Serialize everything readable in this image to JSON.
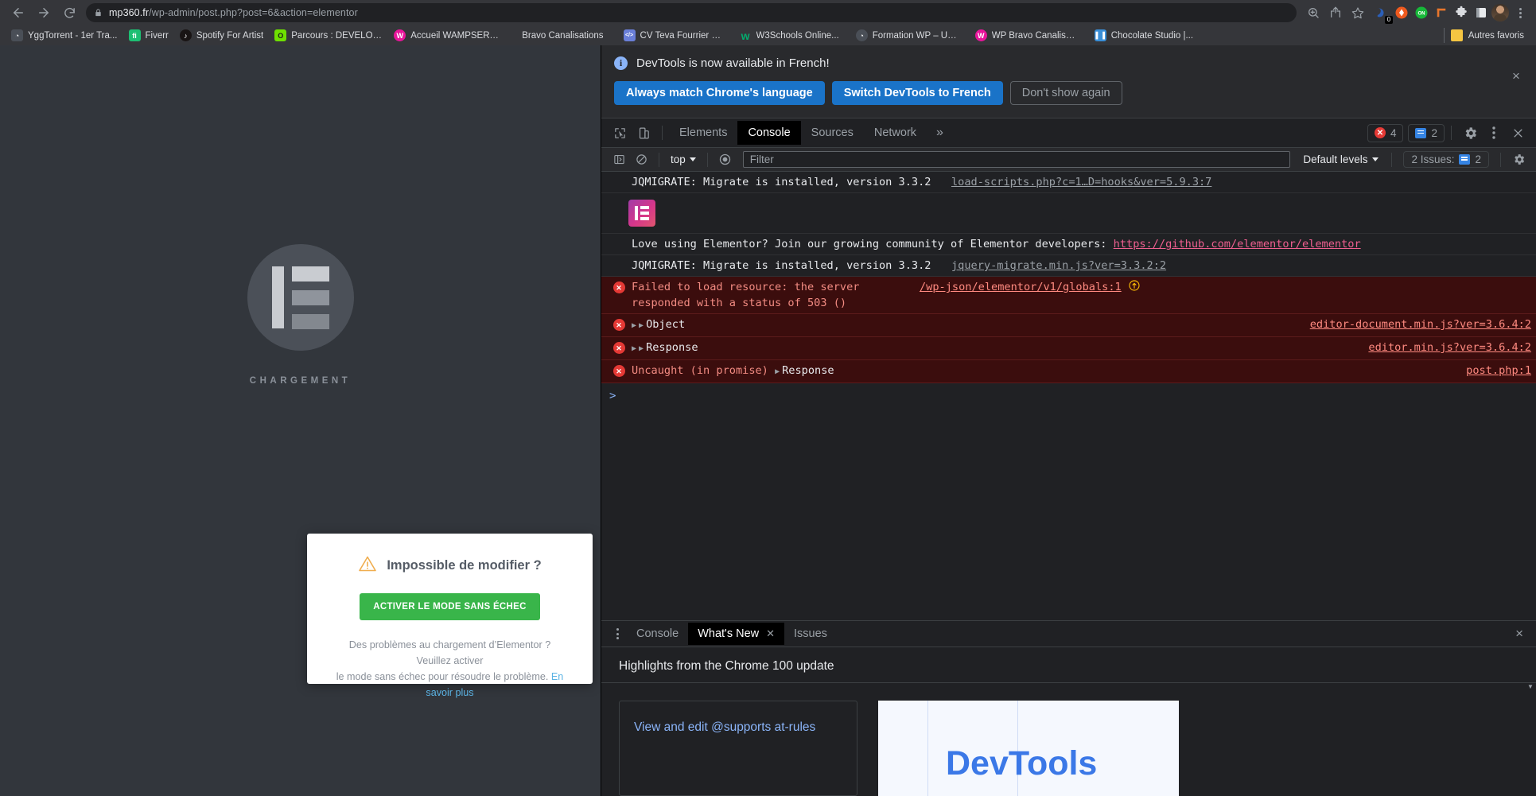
{
  "browser": {
    "url_host": "mp360.fr",
    "url_path": "/wp-admin/post.php?post=6&action=elementor",
    "nav": {
      "back": "Back",
      "forward": "Forward",
      "reload": "Reload"
    },
    "omnibox_icons": [
      "zoom-icon",
      "share-icon",
      "bookmark-star-icon"
    ],
    "extensions": [
      {
        "name": "mendeley-extension",
        "badge": "0"
      },
      {
        "name": "diamond-extension",
        "badge": ""
      },
      {
        "name": "on-toggle-extension",
        "badge": ""
      },
      {
        "name": "orange-tool-extension",
        "badge": ""
      },
      {
        "name": "puzzle-extensions-menu",
        "badge": ""
      },
      {
        "name": "sidepanel-extension",
        "badge": ""
      }
    ],
    "bookmarks": [
      {
        "label": "YggTorrent - 1er Tra...",
        "color": "#4a4f57",
        "glyph": "◔"
      },
      {
        "label": "Fiverr",
        "color": "#1dbf73",
        "glyph": "fi"
      },
      {
        "label": "Spotify For Artist",
        "color": "#191414",
        "glyph": "♫"
      },
      {
        "label": "Parcours : DÉVELOP...",
        "color": "#6ee000",
        "glyph": "O"
      },
      {
        "label": "Accueil WAMPSERV...",
        "color": "#e8159b",
        "glyph": "W"
      },
      {
        "label": "Bravo Canalisations",
        "color": "transparent",
        "glyph": ""
      },
      {
        "label": "CV Teva Fourrier 20...",
        "color": "#6a7fd8",
        "glyph": "</>"
      },
      {
        "label": "W3Schools Online...",
        "color": "#04aa6d",
        "glyph": "w"
      },
      {
        "label": "Formation WP – Un...",
        "color": "#4a4f57",
        "glyph": "◔"
      },
      {
        "label": "WP Bravo Canalisati...",
        "color": "#e8159b",
        "glyph": "W"
      },
      {
        "label": "Chocolate Studio |...",
        "color": "#3a8fd8",
        "glyph": "▏▐"
      }
    ],
    "other_bookmarks": "Autres favoris"
  },
  "page": {
    "loading_label": "CHARGEMENT",
    "dialog": {
      "title": "Impossible de modifier ?",
      "button": "ACTIVER LE MODE SANS ÉCHEC",
      "description_1": "Des problèmes au chargement d’Elementor ? Veuillez activer",
      "description_2": "le mode sans échec pour résoudre le problème. ",
      "link": "En savoir plus"
    }
  },
  "devtools": {
    "banner": {
      "message": "DevTools is now available in French!",
      "btn_always": "Always match Chrome's language",
      "btn_switch": "Switch DevTools to French",
      "btn_dismiss": "Don't show again",
      "close": "×"
    },
    "tabs": [
      {
        "label": "Elements",
        "active": false
      },
      {
        "label": "Console",
        "active": true
      },
      {
        "label": "Sources",
        "active": false
      },
      {
        "label": "Network",
        "active": false
      }
    ],
    "more_tabs": "»",
    "error_count": "4",
    "message_count": "2",
    "filterbar": {
      "context": "top",
      "filter_placeholder": "Filter",
      "levels": "Default levels",
      "issues": "2 Issues:",
      "issues_count": "2"
    },
    "console_messages": [
      {
        "kind": "log",
        "text": "JQMIGRATE: Migrate is installed, version 3.3.2",
        "source": "load-scripts.php?c=1…D=hooks&ver=5.9.3:7",
        "has_issue_icon": false
      },
      {
        "kind": "logo",
        "text": "",
        "source": "",
        "has_issue_icon": false
      },
      {
        "kind": "brand",
        "text": "Love using Elementor? Join our growing community of Elementor developers: ",
        "link": "https://github.com/elementor/elementor",
        "source": "",
        "has_issue_icon": false
      },
      {
        "kind": "log",
        "text": "JQMIGRATE: Migrate is installed, version 3.3.2",
        "source": "jquery-migrate.min.js?ver=3.3.2:2",
        "has_issue_icon": false
      },
      {
        "kind": "error",
        "text": "Failed to load resource: the server responded with a status of 503 ()",
        "source": "/wp-json/elementor/v1/globals:1",
        "has_issue_icon": true
      },
      {
        "kind": "error-object",
        "text": "Object",
        "source": "editor-document.min.js?ver=3.6.4:2",
        "has_issue_icon": false
      },
      {
        "kind": "error-object",
        "text": "Response",
        "source": "editor.min.js?ver=3.6.4:2",
        "has_issue_icon": false
      },
      {
        "kind": "error-uncaught",
        "text": "Uncaught (in promise) ",
        "object": "Response",
        "source": "post.php:1",
        "has_issue_icon": false
      }
    ],
    "prompt": ">",
    "drawer": {
      "tabs": [
        {
          "label": "Console",
          "active": false,
          "closable": false
        },
        {
          "label": "What's New",
          "active": true,
          "closable": true
        },
        {
          "label": "Issues",
          "active": false,
          "closable": false
        }
      ],
      "close": "×",
      "heading": "Highlights from the Chrome 100 update",
      "card_title": "View and edit @supports at-rules",
      "image_text": "DevTools"
    }
  }
}
